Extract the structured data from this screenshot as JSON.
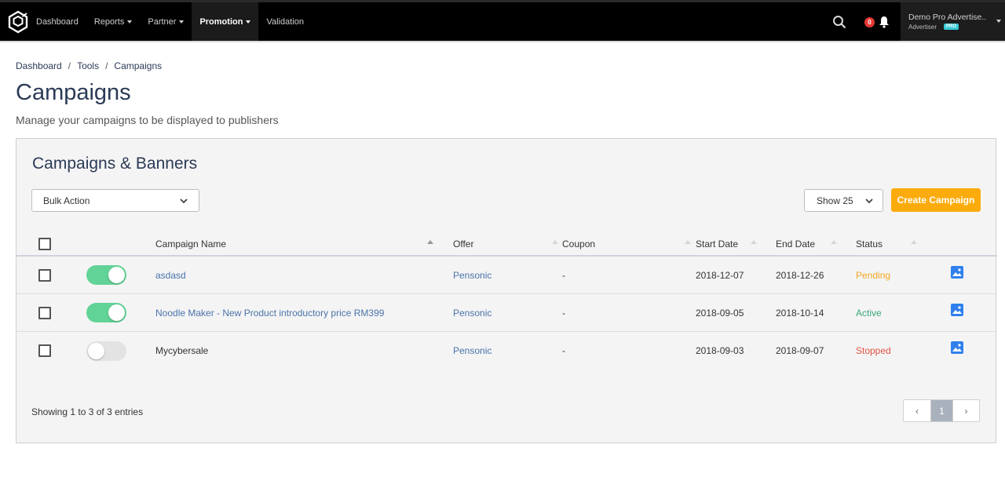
{
  "nav": {
    "items": [
      {
        "label": "Dashboard",
        "dropdown": false,
        "active": false
      },
      {
        "label": "Reports",
        "dropdown": true,
        "active": false
      },
      {
        "label": "Partner",
        "dropdown": true,
        "active": false
      },
      {
        "label": "Promotion",
        "dropdown": true,
        "active": true
      },
      {
        "label": "Validation",
        "dropdown": false,
        "active": false
      }
    ],
    "notification_count": "0",
    "user_name": "Demo Pro Advertise...",
    "user_role": "Advertiser",
    "user_badge": "PRO"
  },
  "breadcrumb": [
    "Dashboard",
    "Tools",
    "Campaigns"
  ],
  "page": {
    "title": "Campaigns",
    "subtitle": "Manage your campaigns to be displayed to publishers"
  },
  "panel": {
    "title": "Campaigns & Banners",
    "bulk_action": "Bulk Action",
    "show_select": "Show 25",
    "create_button": "Create Campaign"
  },
  "table": {
    "headers": {
      "name": "Campaign Name",
      "offer": "Offer",
      "coupon": "Coupon",
      "start": "Start Date",
      "end": "End Date",
      "status": "Status"
    },
    "rows": [
      {
        "enabled": true,
        "name": "asdasd",
        "name_link": true,
        "offer": "Pensonic",
        "coupon": "-",
        "start": "2018-12-07",
        "end": "2018-12-26",
        "status": "Pending",
        "status_color": "#f5a623"
      },
      {
        "enabled": true,
        "name": "Noodle Maker - New Product introductory price RM399",
        "name_link": true,
        "offer": "Pensonic",
        "coupon": "-",
        "start": "2018-09-05",
        "end": "2018-10-14",
        "status": "Active",
        "status_color": "#3aa776"
      },
      {
        "enabled": false,
        "name": "Mycybersale",
        "name_link": false,
        "offer": "Pensonic",
        "coupon": "-",
        "start": "2018-09-03",
        "end": "2018-09-07",
        "status": "Stopped",
        "status_color": "#e0533f"
      }
    ]
  },
  "footer": {
    "info": "Showing 1 to 3 of 3 entries",
    "prev": "‹",
    "current_page": "1",
    "next": "›"
  },
  "colors": {
    "accent": "#fbab0b",
    "toggle_on": "#62d397",
    "link": "#4a73a8",
    "image_icon": "#2f80ed"
  }
}
